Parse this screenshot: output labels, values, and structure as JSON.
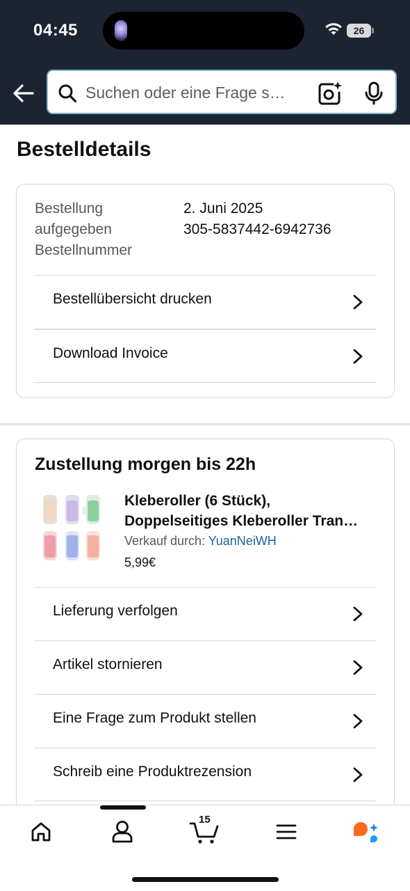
{
  "status_bar": {
    "time": "04:45",
    "battery": "26"
  },
  "header": {
    "back_icon": "arrow-left-icon",
    "search": {
      "placeholder": "Suchen oder eine Frage s…",
      "value": ""
    },
    "icons": [
      "search-icon",
      "camera-sparkle-icon",
      "microphone-icon"
    ]
  },
  "page": {
    "title": "Bestelldetails"
  },
  "order_card": {
    "labels": [
      "Bestellung",
      "aufgegeben",
      "Bestellnummer"
    ],
    "values": [
      "2. Juni 2025",
      "305-5837442-6942736"
    ],
    "actions": [
      {
        "label": "Bestellübersicht drucken"
      },
      {
        "label": "Download Invoice"
      }
    ]
  },
  "delivery_card": {
    "title": "Zustellung morgen bis 22h",
    "product": {
      "title_line1": "Kleberoller (6 Stück),",
      "title_line2": "Doppelseitiges Kleberoller Tran…",
      "seller_prefix": "Verkauf durch:",
      "seller_name": "YuanNeiWH",
      "price": "5,99€"
    },
    "actions": [
      {
        "label": "Lieferung verfolgen"
      },
      {
        "label": "Artikel stornieren"
      },
      {
        "label": "Eine Frage zum Produkt stellen"
      },
      {
        "label": "Schreib eine Produktrezension"
      }
    ]
  },
  "bottom_nav": {
    "items": [
      "home-icon",
      "account-icon",
      "cart-icon",
      "menu-icon",
      "rufus-icon"
    ],
    "cart_count": "15"
  },
  "colors": {
    "header_bg": "#1c2432",
    "link": "#2162a1",
    "border": "#d5d9d9",
    "text": "#0f1111",
    "muted": "#565959"
  }
}
